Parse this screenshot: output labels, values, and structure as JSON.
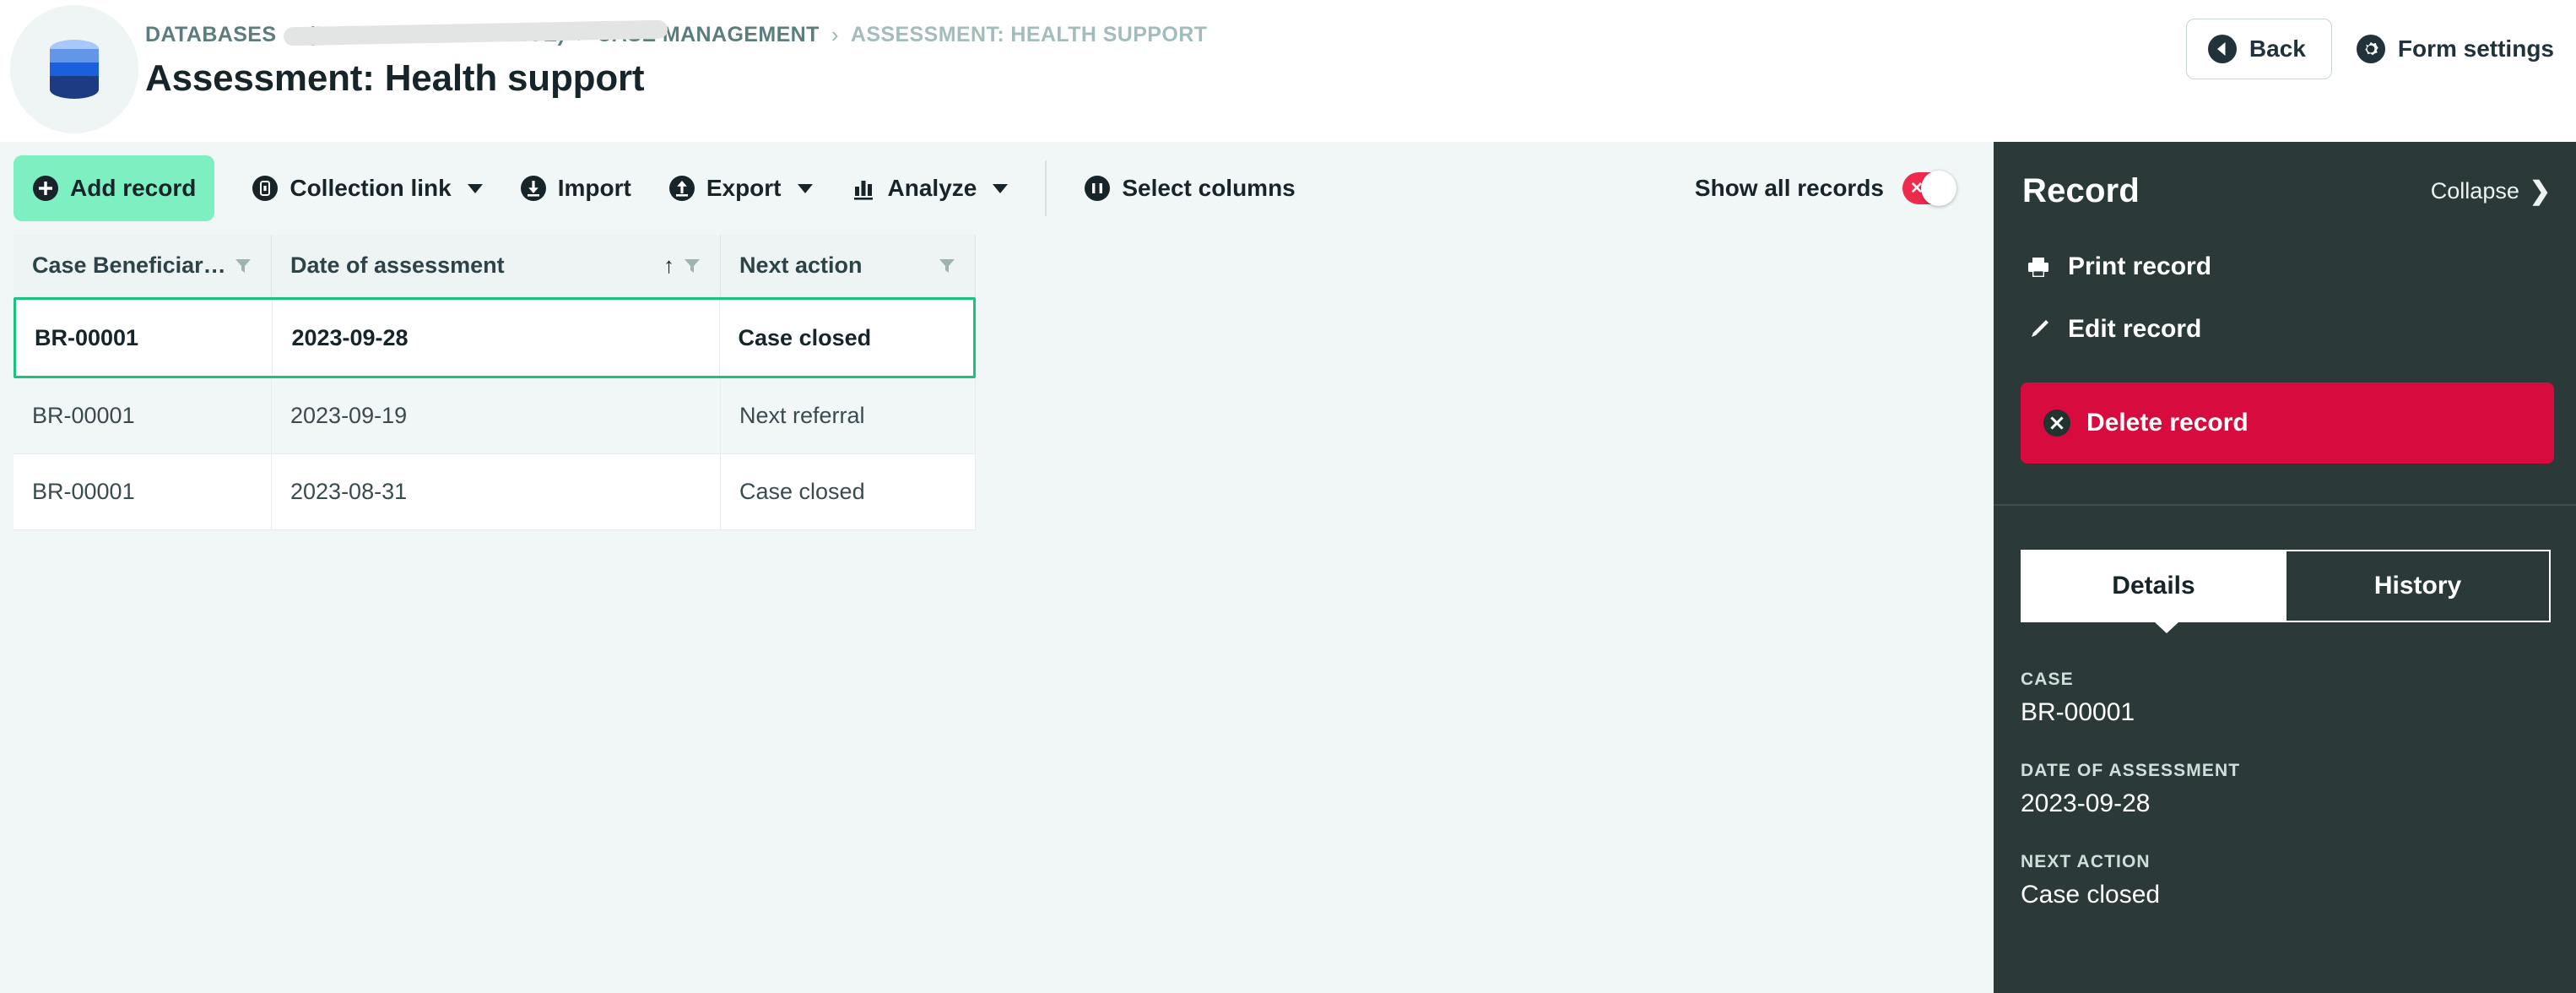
{
  "header": {
    "logo_icon": "database-icon",
    "breadcrumb": {
      "items": [
        {
          "label": "DATABASES",
          "state": "link"
        },
        {
          "label": "(REVERSE REFERENCE)",
          "state": "redacted"
        },
        {
          "label": "CASE MANAGEMENT",
          "state": "link"
        },
        {
          "label": "ASSESSMENT: HEALTH SUPPORT",
          "state": "current"
        }
      ],
      "separator": "›"
    },
    "title": "Assessment: Health support",
    "actions": {
      "back_label": "Back",
      "back_icon": "back-arrow-circle-icon",
      "form_settings_label": "Form settings",
      "form_settings_icon": "gear-icon"
    }
  },
  "toolbar": {
    "add_record_label": "Add record",
    "add_record_icon": "plus-circle-icon",
    "collection_link_label": "Collection link",
    "collection_link_icon": "link-circle-icon",
    "import_label": "Import",
    "import_icon": "download-circle-icon",
    "export_label": "Export",
    "export_icon": "upload-circle-icon",
    "analyze_label": "Analyze",
    "analyze_icon": "bar-chart-icon",
    "select_columns_label": "Select columns",
    "select_columns_icon": "columns-circle-icon",
    "show_all_records_label": "Show all records",
    "toggle_state": "off",
    "toggle_mark": "✕",
    "accent_green": "#7eefc0",
    "toggle_red": "#ef2b4d"
  },
  "table": {
    "columns": [
      {
        "label": "Case Beneficiar…",
        "sorted": false,
        "filter_icon": "filter-icon"
      },
      {
        "label": "Date of assessment",
        "sorted": true,
        "sort_arrow": "↑",
        "filter_icon": "filter-icon"
      },
      {
        "label": "Next action",
        "sorted": false,
        "filter_icon": "filter-icon"
      }
    ],
    "rows": [
      {
        "case": "BR-00001",
        "date": "2023-09-28",
        "next_action": "Case closed",
        "selected": true
      },
      {
        "case": "BR-00001",
        "date": "2023-09-19",
        "next_action": "Next referral",
        "selected": false
      },
      {
        "case": "BR-00001",
        "date": "2023-08-31",
        "next_action": "Case closed",
        "selected": false
      }
    ],
    "selection_color": "#19c37d"
  },
  "record_panel": {
    "title": "Record",
    "collapse_label": "Collapse",
    "collapse_icon": "chevron-right-icon",
    "print_label": "Print record",
    "print_icon": "printer-icon",
    "edit_label": "Edit record",
    "edit_icon": "pencil-icon",
    "delete_label": "Delete record",
    "delete_icon": "x-circle-icon",
    "delete_color": "#d80b3f",
    "panel_bg": "#2b3a38",
    "tabs": [
      {
        "label": "Details",
        "active": true
      },
      {
        "label": "History",
        "active": false
      }
    ],
    "fields": [
      {
        "label": "CASE",
        "value": "BR-00001"
      },
      {
        "label": "DATE OF ASSESSMENT",
        "value": "2023-09-28"
      },
      {
        "label": "NEXT ACTION",
        "value": "Case closed"
      }
    ]
  }
}
